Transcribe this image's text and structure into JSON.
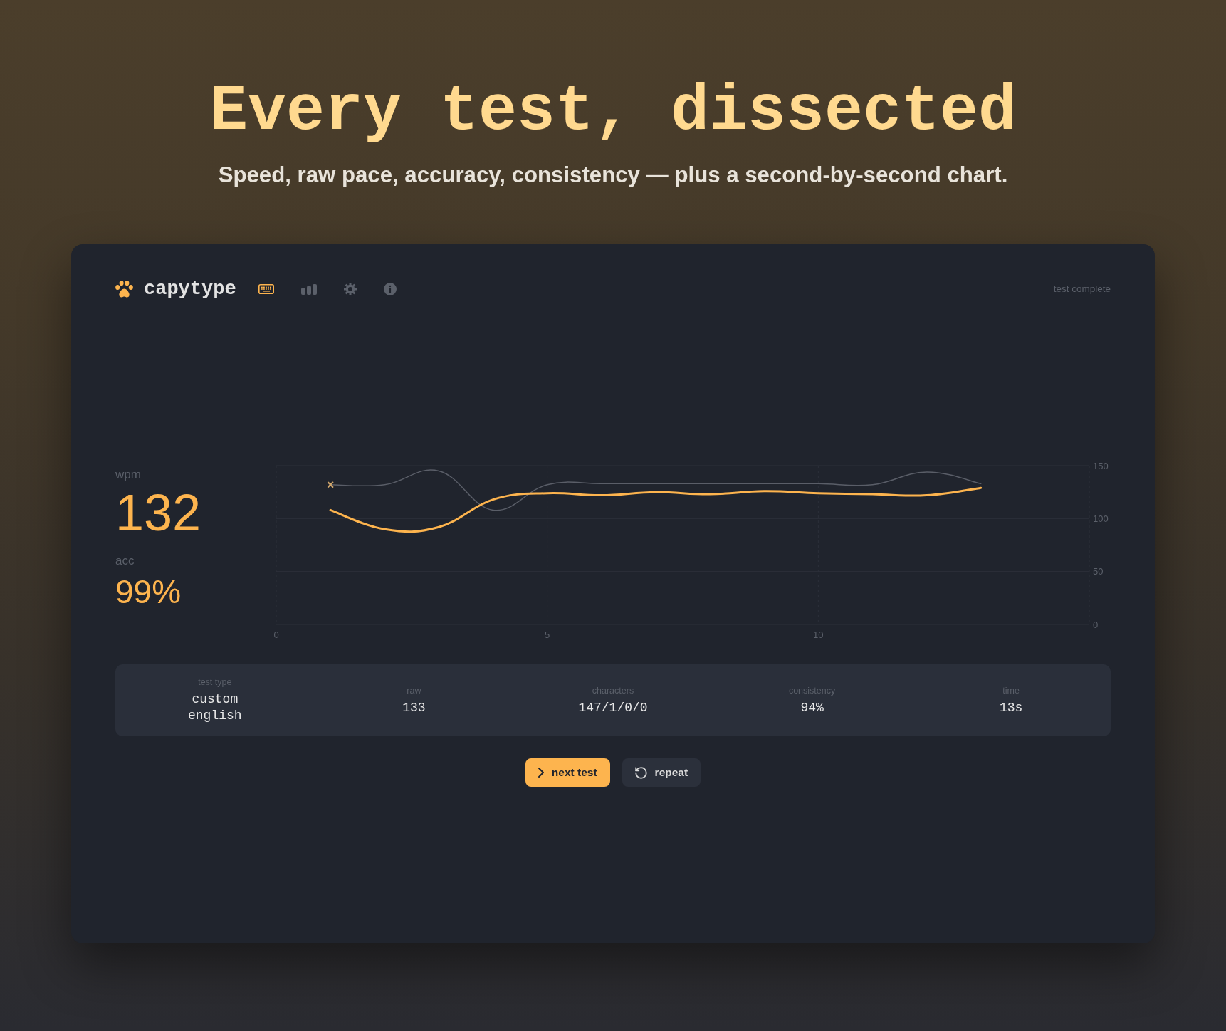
{
  "headline": "Every test, dissected",
  "subtitle": "Speed, raw pace, accuracy, consistency — plus a second-by-second chart.",
  "app": {
    "logo": "capytype",
    "nav": [
      {
        "selected": true
      },
      {
        "selected": false
      },
      {
        "selected": false
      },
      {
        "selected": false
      }
    ],
    "status": "test complete",
    "results": {
      "wpm_label": "wpm",
      "wpm": "132",
      "acc_label": "acc",
      "acc": "99%"
    },
    "chart_data": {
      "type": "line",
      "grid": true,
      "x": [
        1,
        2,
        3,
        4,
        5,
        6,
        7,
        8,
        9,
        10,
        11,
        12,
        13
      ],
      "xlim": [
        0,
        15
      ],
      "ylim": [
        0,
        150
      ],
      "xticks": [
        0,
        5,
        10
      ],
      "yticks": [
        0,
        50,
        100,
        150
      ],
      "series": [
        {
          "color": "#5a5e68",
          "values": [
            132,
            132,
            145,
            108,
            132,
            133,
            133,
            133,
            133,
            133,
            132,
            144,
            133
          ]
        },
        {
          "color": "#fdb44e",
          "values": [
            108,
            90,
            92,
            118,
            124,
            122,
            125,
            123,
            126,
            124,
            123,
            122,
            129
          ]
        },
        {
          "color": "#cfa66c",
          "marker": "x",
          "values": [
            132,
            null,
            null,
            null,
            null,
            null,
            null,
            null,
            null,
            null,
            null,
            null,
            null
          ]
        }
      ]
    },
    "stats": [
      {
        "label": "test type",
        "value": "custom english"
      },
      {
        "label": "raw",
        "value": "133"
      },
      {
        "label": "characters",
        "value": "147/1/0/0"
      },
      {
        "label": "consistency",
        "value": "94%"
      },
      {
        "label": "time",
        "value": "13s"
      }
    ],
    "buttons": [
      {
        "label": "next test",
        "kind": "primary"
      },
      {
        "label": "repeat",
        "kind": "secondary"
      }
    ]
  }
}
